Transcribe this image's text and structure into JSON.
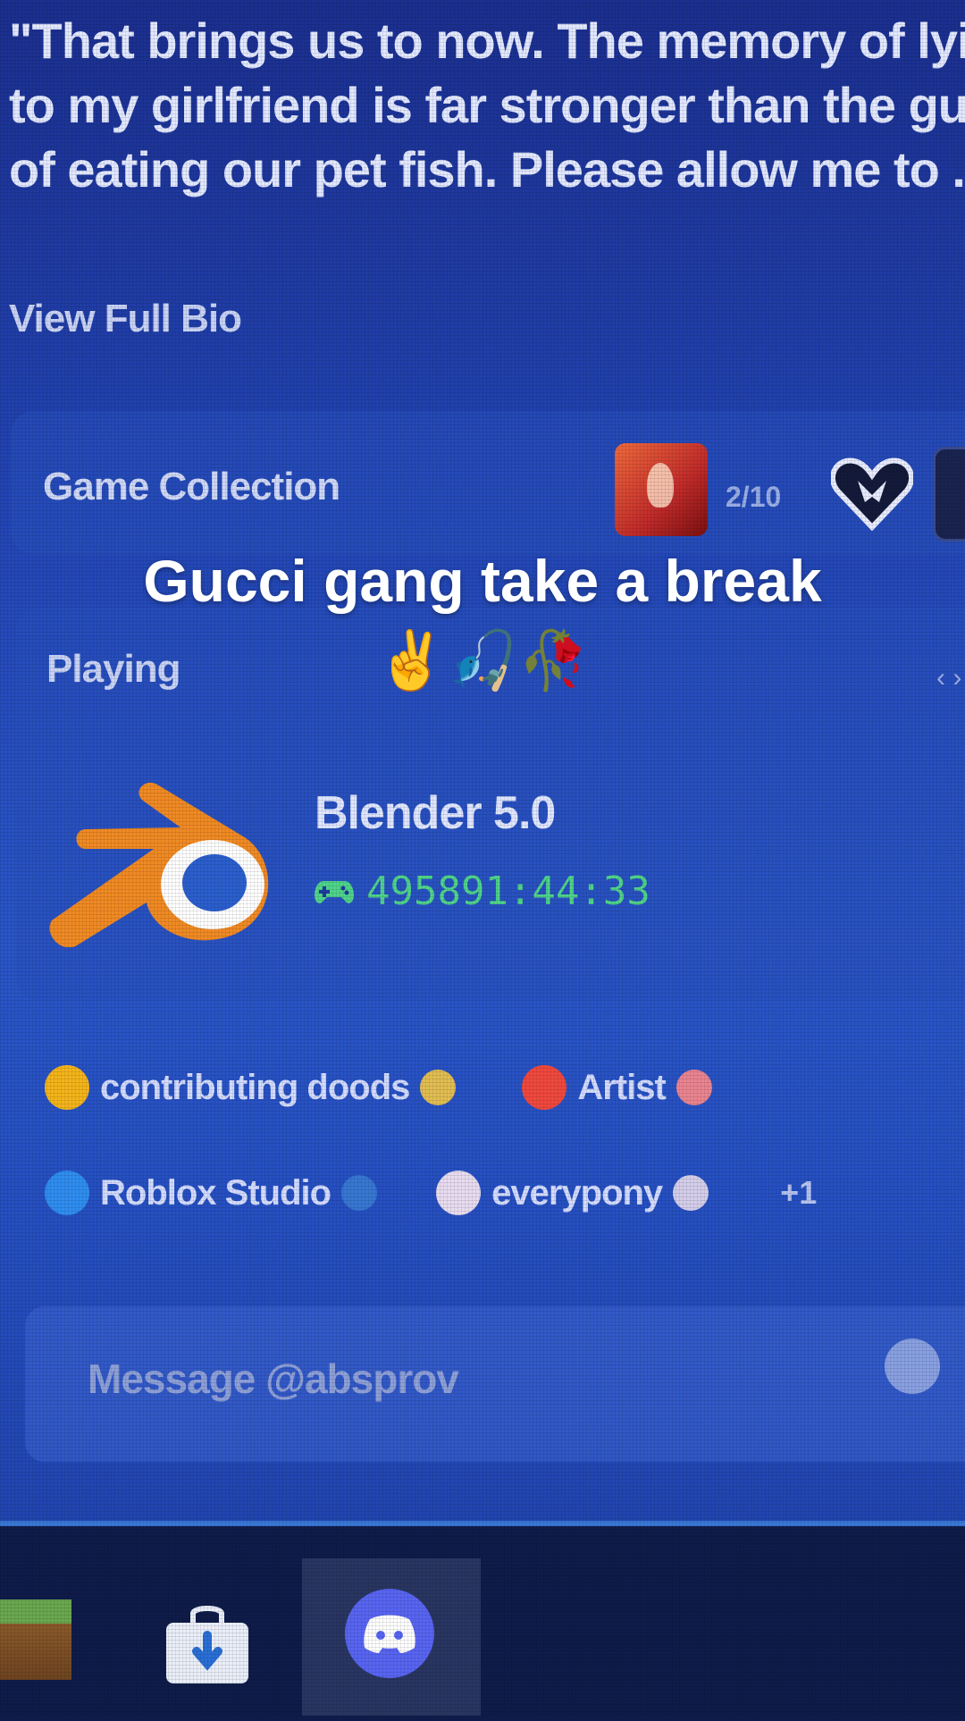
{
  "bio": {
    "lines": [
      "\"That brings us to now. The memory of lyi",
      "to my girlfriend is far stronger than the gu",
      "of eating our pet fish. Please allow me to ."
    ],
    "view_full_bio": "View Full Bio"
  },
  "game_collection": {
    "label": "Game Collection",
    "count_text": "2/10"
  },
  "playing": {
    "label": "Playing",
    "more": "‹ ›",
    "game_title": "Blender 5.0",
    "elapsed": "495891:44:33",
    "icon": "blender-icon"
  },
  "roles": [
    {
      "name": "contributing doods",
      "color": "#f4b41a",
      "badge_color": "#f6c945"
    },
    {
      "name": "Artist",
      "color": "#f0493e",
      "badge_color": "#ff8a8a"
    },
    {
      "name": "Roblox Studio",
      "color": "#2f8df0",
      "badge_color": "#3a7bd5"
    },
    {
      "name": "everypony",
      "color": "#e8dcf0",
      "badge_color": "#e8dcf0"
    }
  ],
  "roles_more": "+1",
  "message": {
    "placeholder": "Message @absprov"
  },
  "overlay": {
    "caption": "Gucci gang take a break",
    "emoji": "✌️🎣🥀"
  }
}
